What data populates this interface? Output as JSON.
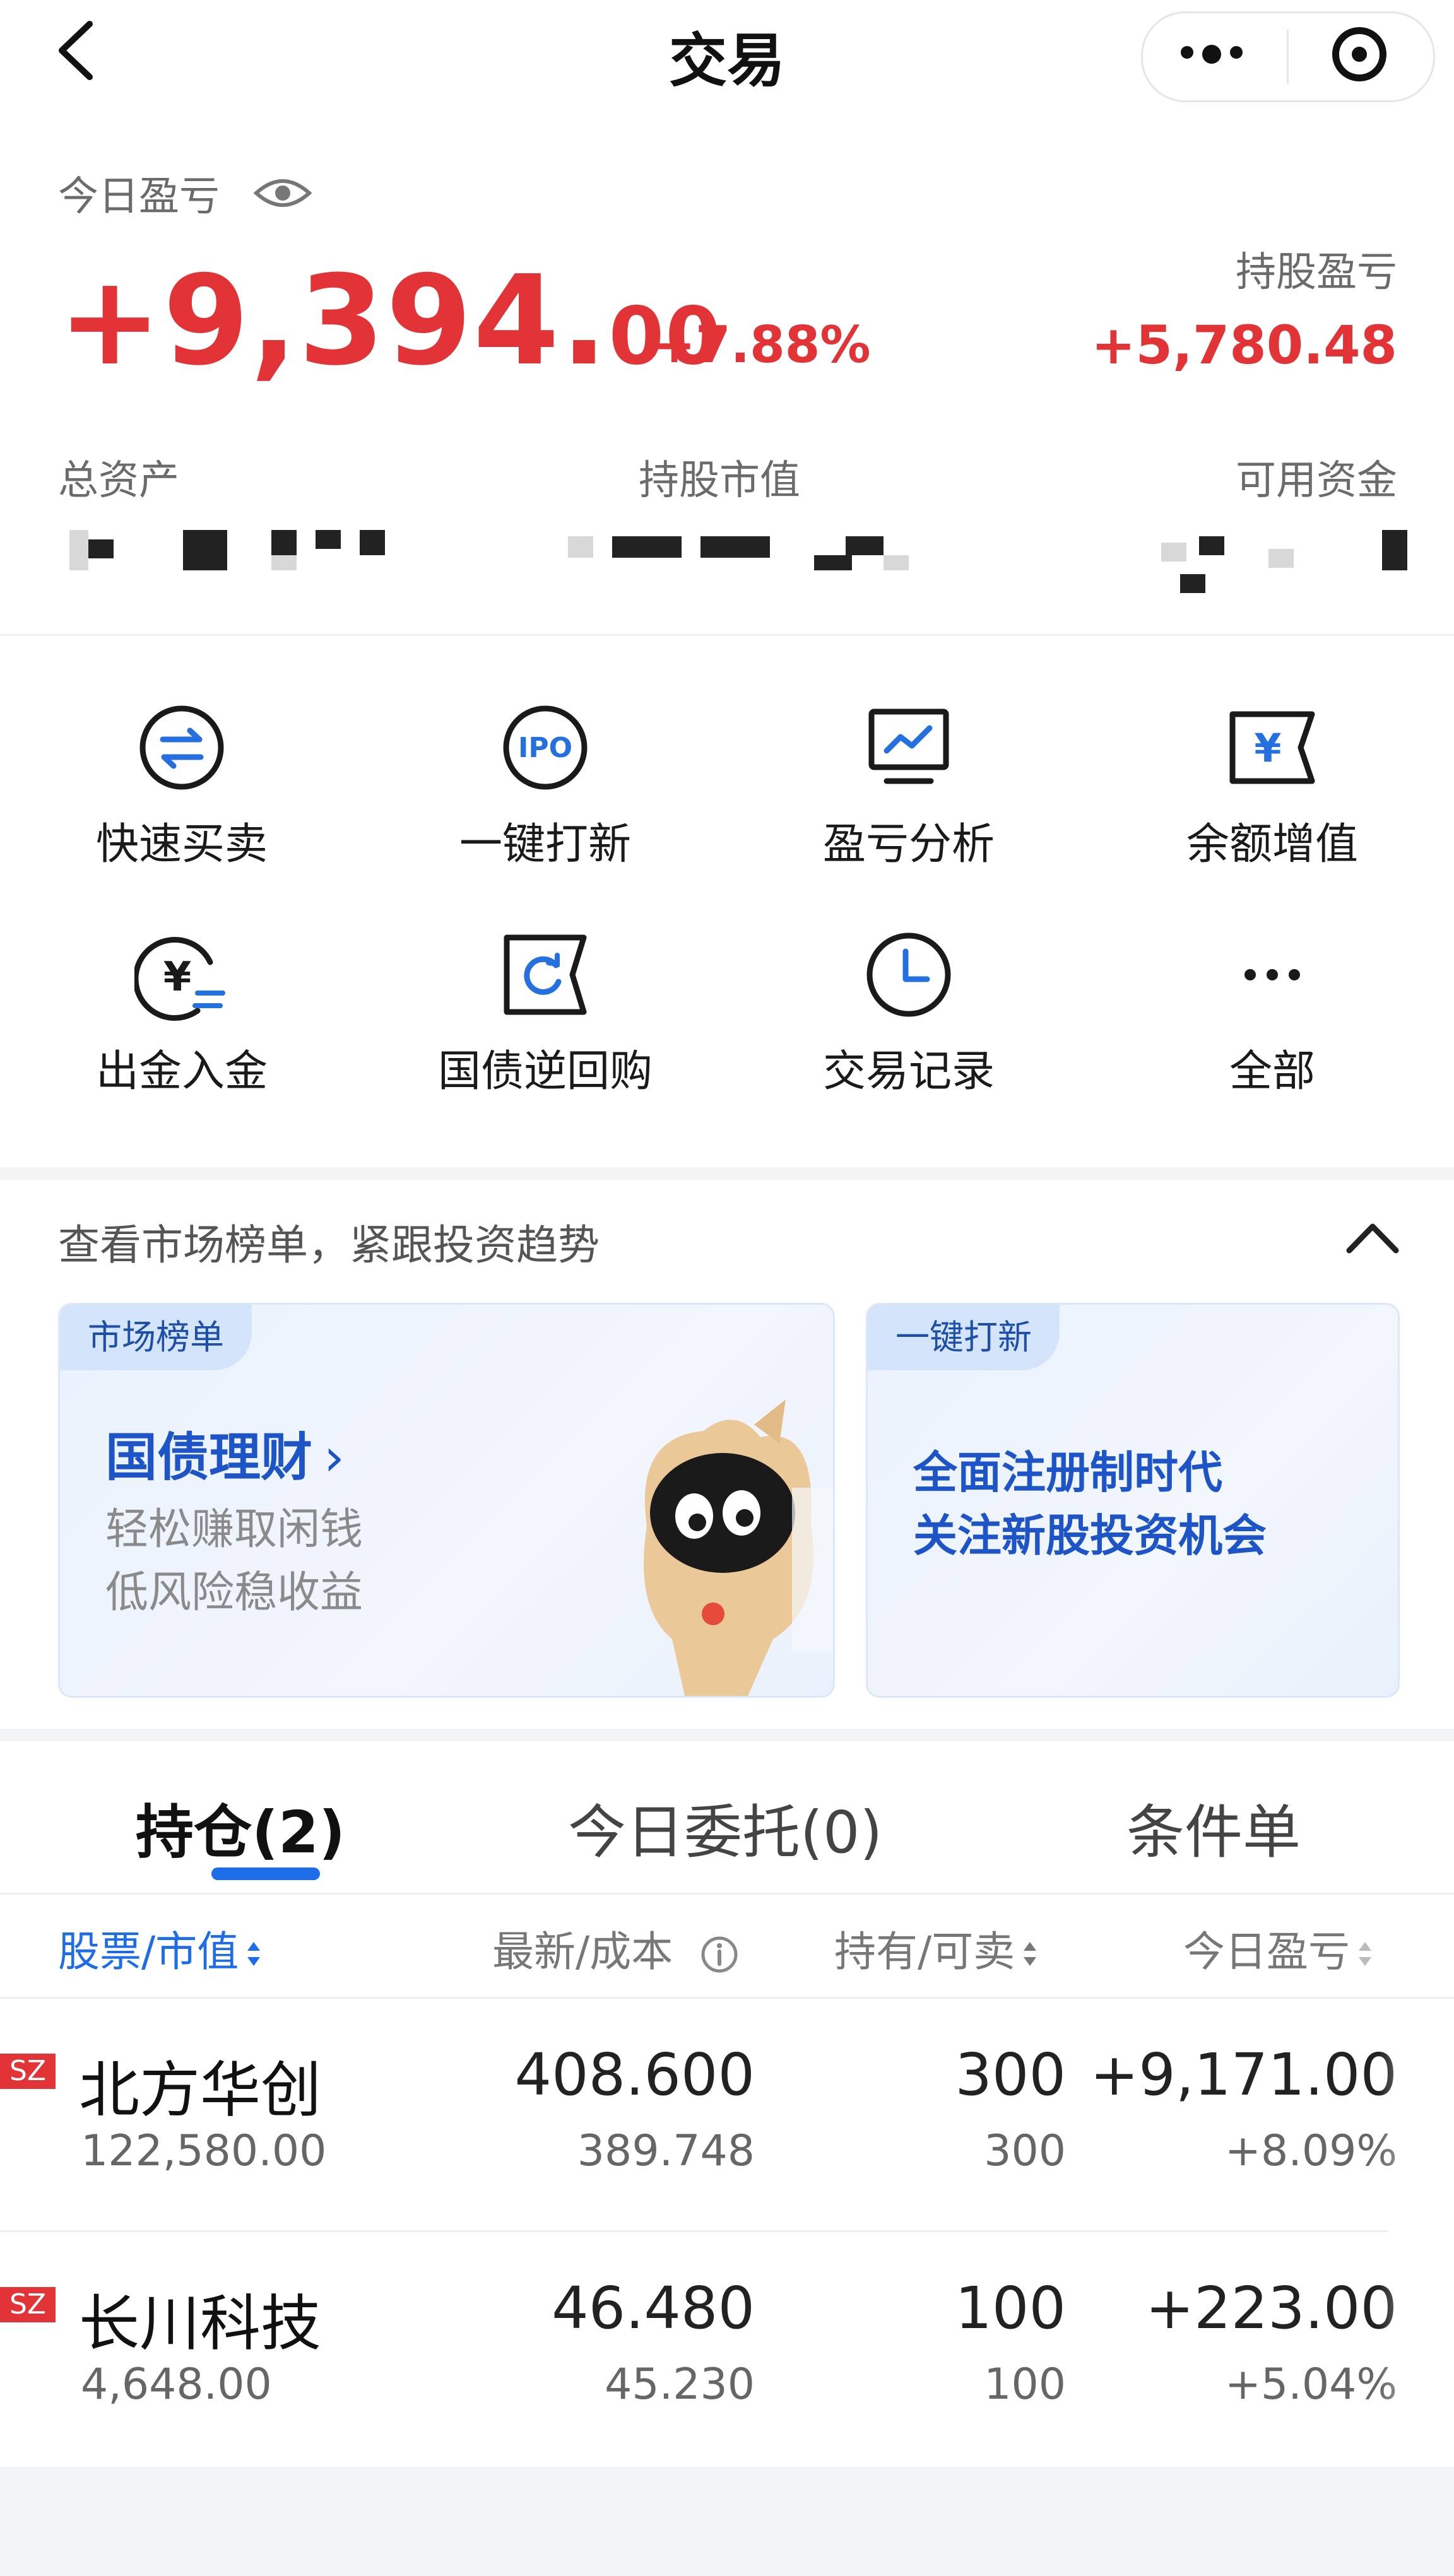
{
  "header": {
    "title": "交易"
  },
  "summary": {
    "today_pl_label": "今日盈亏",
    "today_pl_int": "+9,394.",
    "today_pl_dec": "00",
    "today_pl_pct": "+7.88%",
    "holding_pl_label": "持股盈亏",
    "holding_pl_value": "+5,780.48",
    "total_assets_label": "总资产",
    "market_value_label": "持股市值",
    "available_label": "可用资金"
  },
  "menu": [
    {
      "label": "快速买卖",
      "icon": "swap-icon"
    },
    {
      "label": "一键打新",
      "icon": "ipo-icon"
    },
    {
      "label": "盈亏分析",
      "icon": "chart-monitor-icon"
    },
    {
      "label": "余额增值",
      "icon": "yen-ticket-icon"
    },
    {
      "label": "出金入金",
      "icon": "yen-transfer-icon"
    },
    {
      "label": "国债逆回购",
      "icon": "refresh-ticket-icon"
    },
    {
      "label": "交易记录",
      "icon": "clock-icon"
    },
    {
      "label": "全部",
      "icon": "more-icon"
    }
  ],
  "market": {
    "section_title": "查看市场榜单，紧跟投资趋势",
    "card1": {
      "tag": "市场榜单",
      "title": "国债理财",
      "line1": "轻松赚取闲钱",
      "line2": "低风险稳收益"
    },
    "card2": {
      "tag": "一键打新",
      "line1": "全面注册制时代",
      "line2": "关注新股投资机会"
    }
  },
  "positions": {
    "tabs": [
      "持仓(2)",
      "今日委托(0)",
      "条件单"
    ],
    "columns": [
      "股票/市值",
      "最新/成本",
      "持有/可卖",
      "今日盈亏"
    ],
    "rows": [
      {
        "market": "SZ",
        "name": "北方华创",
        "value": "122,580.00",
        "latest": "408.600",
        "cost": "389.748",
        "hold": "300",
        "sellable": "300",
        "pl": "+9,171.00",
        "pl_pct": "+8.09%"
      },
      {
        "market": "SZ",
        "name": "长川科技",
        "value": "4,648.00",
        "latest": "46.480",
        "cost": "45.230",
        "hold": "100",
        "sellable": "100",
        "pl": "+223.00",
        "pl_pct": "+5.04%"
      }
    ]
  },
  "colors": {
    "red": "#e23436",
    "blue": "#1e6de8",
    "card_blue": "#1d55c9"
  }
}
